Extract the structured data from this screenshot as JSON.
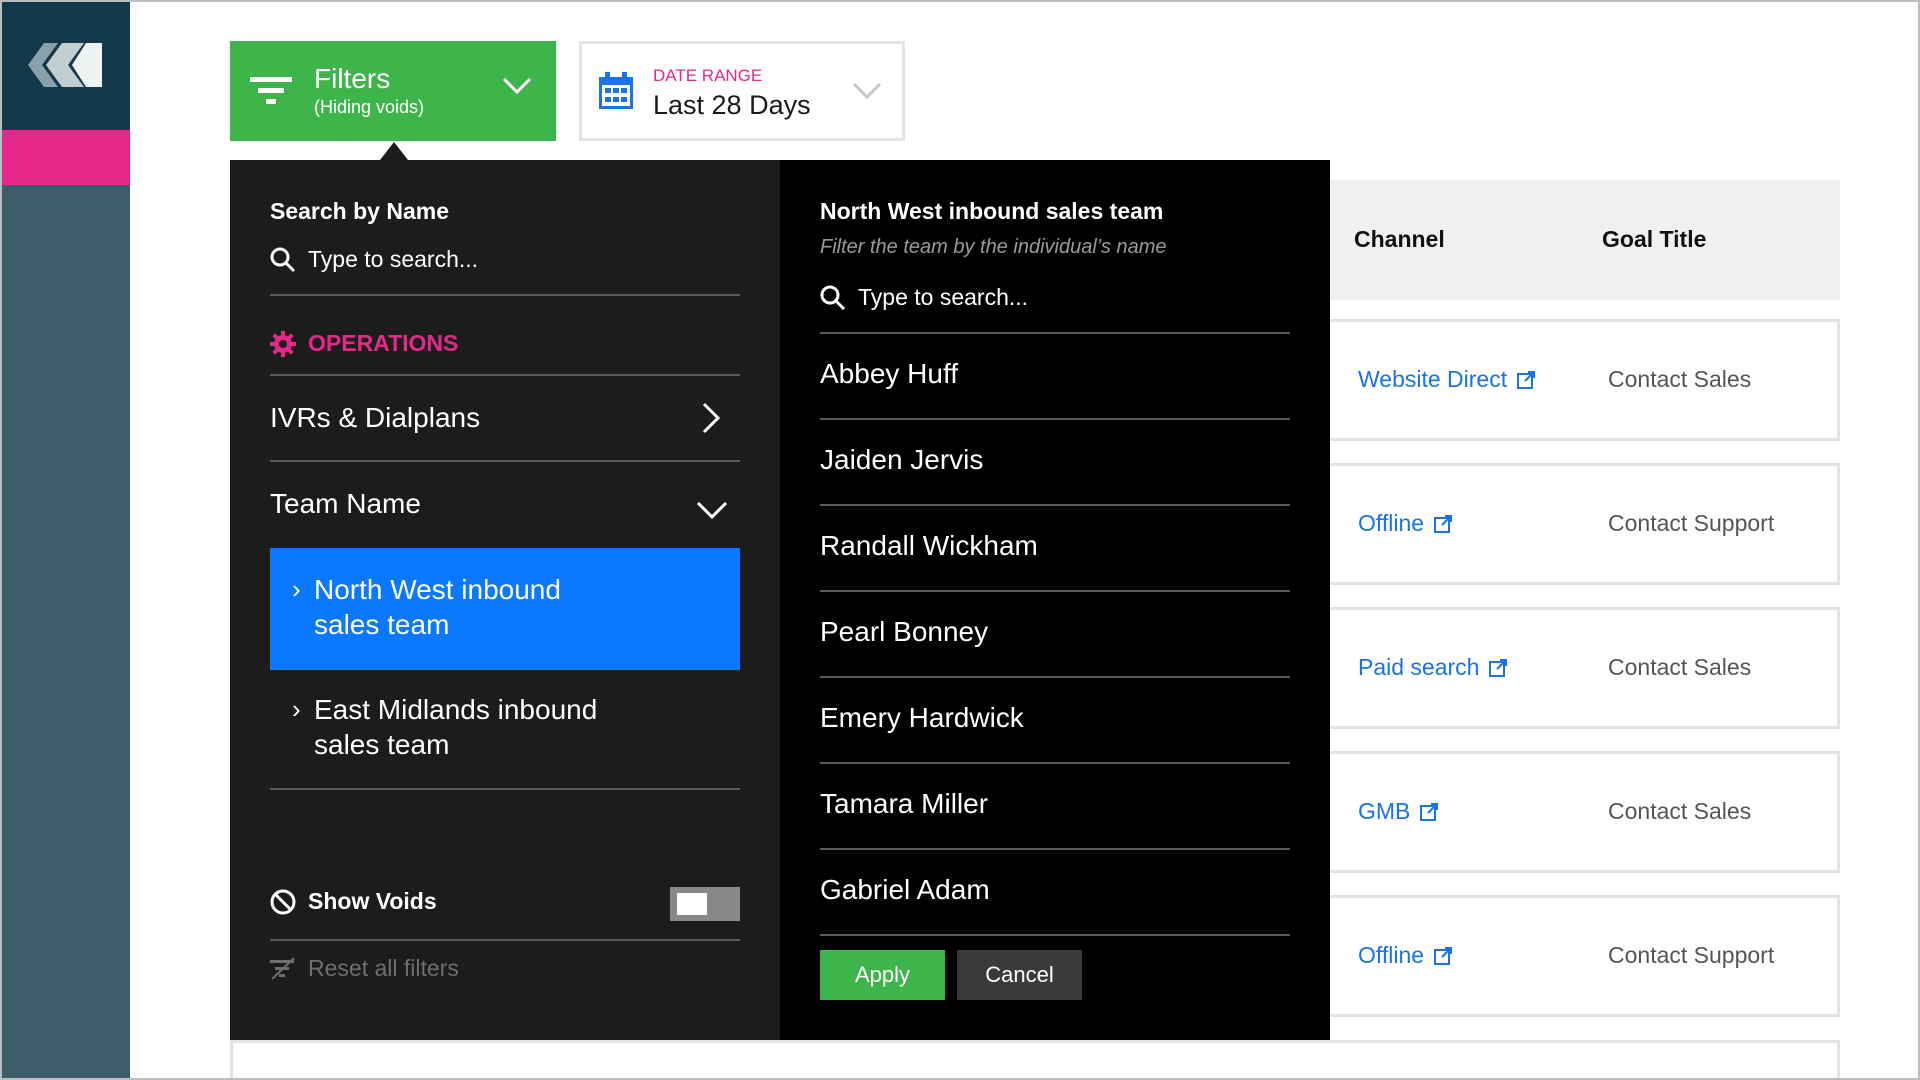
{
  "colors": {
    "accent_green": "#3db54a",
    "accent_pink": "#e6288a",
    "accent_blue": "#0a78ff",
    "link_blue": "#1a73e8",
    "sidebar": "#3e5d6b",
    "sidebar_logo_bg": "#12384a"
  },
  "filters_button": {
    "title": "Filters",
    "subtitle": "(Hiding voids)",
    "icon": "filter-icon"
  },
  "date_range": {
    "label": "DATE RANGE",
    "value": "Last 28 Days",
    "icon": "calendar-icon"
  },
  "table": {
    "headers": [
      "Channel",
      "Goal Title"
    ],
    "rows": [
      {
        "channel": "Website Direct",
        "goal": "Contact Sales"
      },
      {
        "channel": "Offline",
        "goal": "Contact Support"
      },
      {
        "channel": "Paid search",
        "goal": "Contact Sales"
      },
      {
        "channel": "GMB",
        "goal": "Contact Sales"
      },
      {
        "channel": "Offline",
        "goal": "Contact Support"
      }
    ]
  },
  "left_panel": {
    "search_heading": "Search by Name",
    "search_placeholder": "Type to search...",
    "section_label": "OPERATIONS",
    "menu": [
      {
        "label": "IVRs & Dialplans"
      },
      {
        "label": "Team Name"
      }
    ],
    "teams": [
      {
        "line1": "North West inbound",
        "line2": "sales team",
        "selected": true
      },
      {
        "line1": "East Midlands inbound",
        "line2": "sales team",
        "selected": false
      }
    ],
    "show_voids_label": "Show Voids",
    "show_voids_on": false,
    "reset_label": "Reset all filters"
  },
  "right_panel": {
    "heading": "North West inbound sales team",
    "subheading": "Filter the team by the individual’s name",
    "search_placeholder": "Type to search...",
    "people": [
      "Abbey Huff",
      "Jaiden Jervis",
      "Randall Wickham",
      "Pearl Bonney",
      "Emery Hardwick",
      "Tamara Miller",
      "Gabriel Adam"
    ],
    "apply_label": "Apply",
    "cancel_label": "Cancel"
  }
}
